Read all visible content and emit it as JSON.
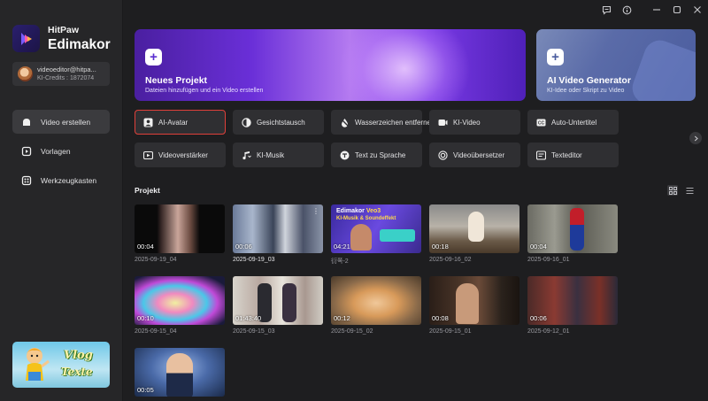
{
  "app": {
    "brand_small": "HitPaw",
    "brand_big": "Edimakor"
  },
  "account": {
    "email": "videoeditor@hitpa...",
    "credits": "KI-Credits : 1872074"
  },
  "sidebar": {
    "items": [
      {
        "label": "Video erstellen",
        "icon": "home-icon"
      },
      {
        "label": "Vorlagen",
        "icon": "templates-icon"
      },
      {
        "label": "Werkzeugkasten",
        "icon": "toolbox-icon"
      }
    ],
    "promo": {
      "line1": "Vlog",
      "line2": "Texte"
    }
  },
  "hero": {
    "new_project": {
      "title": "Neues Projekt",
      "subtitle": "Dateien hinzufügen und ein Video erstellen"
    },
    "ai_generator": {
      "title": "AI Video Generator",
      "subtitle": "KI-Idee oder Skript zu Video"
    }
  },
  "tools": [
    {
      "label": "AI-Avatar",
      "icon": "avatar-icon"
    },
    {
      "label": "Gesichtstausch",
      "icon": "face-swap-icon"
    },
    {
      "label": "Wasserzeichen entfernen",
      "icon": "watermark-icon"
    },
    {
      "label": "KI-Video",
      "icon": "ai-video-icon"
    },
    {
      "label": "Auto-Untertitel",
      "icon": "subtitle-icon"
    },
    {
      "label": "Videoverstärker",
      "icon": "enhancer-icon"
    },
    {
      "label": "KI-Musik",
      "icon": "music-icon"
    },
    {
      "label": "Text zu Sprache",
      "icon": "tts-icon"
    },
    {
      "label": "Videoübersetzer",
      "icon": "translate-icon"
    },
    {
      "label": "Texteditor",
      "icon": "text-editor-icon"
    }
  ],
  "projects": {
    "title": "Projekt",
    "items": [
      {
        "duration": "00:04",
        "name": "2025-09-19_04"
      },
      {
        "duration": "00:06",
        "name": "2025-09-19_03"
      },
      {
        "duration": "04:21",
        "name": "衍쪽-2",
        "thumb_text1": "Edimakor",
        "thumb_text2": "Veo3",
        "thumb_text3": "KI-Musik & Soundeffekt"
      },
      {
        "duration": "00:18",
        "name": "2025-09-16_02"
      },
      {
        "duration": "00:04",
        "name": "2025-09-16_01"
      },
      {
        "duration": "00:10",
        "name": "2025-09-15_04"
      },
      {
        "duration": "01:43:40",
        "name": "2025-09-15_03"
      },
      {
        "duration": "00:12",
        "name": "2025-09-15_02"
      },
      {
        "duration": "00:08",
        "name": "2025-09-15_01"
      },
      {
        "duration": "00:06",
        "name": "2025-09-12_01"
      },
      {
        "duration": "00:05",
        "name": ""
      }
    ]
  }
}
